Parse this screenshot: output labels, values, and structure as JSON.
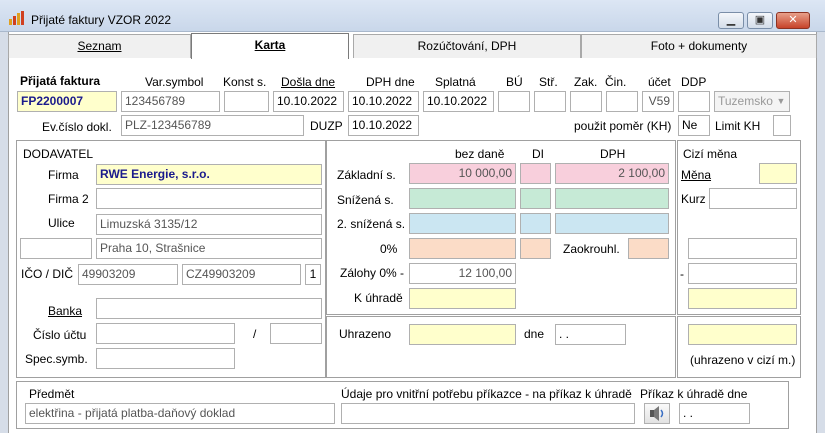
{
  "window": {
    "title": "Přijaté faktury VZOR 2022",
    "min": "▭",
    "max": "□",
    "close": "✕",
    "icon": "chart-icon"
  },
  "tabs": [
    {
      "label": "Seznam"
    },
    {
      "label": "Karta"
    },
    {
      "label": "Rozúčtování, DPH"
    },
    {
      "label": "Foto + dokumenty"
    }
  ],
  "header": {
    "labels": {
      "invoice": "Přijatá faktura",
      "varsym": "Var.symbol",
      "konst": "Konst s.",
      "dosla": "Došla dne",
      "dphdne": "DPH dne",
      "splatna": "Splatná",
      "bu": "BÚ",
      "str": "Stř.",
      "zak": "Zak.",
      "cin": "Čin.",
      "ucet": "účet",
      "ddp": "DDP",
      "evc": "Ev.číslo dokl.",
      "duzp": "DUZP",
      "pomer": "použit poměr (KH)",
      "limit": "Limit KH"
    },
    "values": {
      "invoice": "FP2200007",
      "varsym": "123456789",
      "konst": "",
      "dosla": "10.10.2022",
      "dphdne": "10.10.2022",
      "splatna": "10.10.2022",
      "bu": "",
      "str": "",
      "zak": "",
      "cin": "",
      "ucet": "V59",
      "ddp": "",
      "tuzemsko": "Tuzemsko",
      "evc": "PLZ-123456789",
      "duzp": "10.10.2022",
      "pomer": "Ne",
      "limit": ""
    }
  },
  "supplier": {
    "title": "DODAVATEL",
    "labels": {
      "firma": "Firma",
      "firma2": "Firma 2",
      "ulice": "Ulice",
      "ico": "IČO / DIČ",
      "banka": "Banka",
      "cislo": "Číslo účtu",
      "slash": "/",
      "spec": "Spec.symb."
    },
    "values": {
      "firma": "RWE Energie, s.r.o.",
      "firma2": "",
      "ulice": "Limuzská 3135/12",
      "psc": "",
      "mesto": "Praha 10, Strašnice",
      "ico": "49903209",
      "dic": "CZ49903209",
      "n": "1",
      "banka": "",
      "cislo": "",
      "kod": "",
      "spec": ""
    }
  },
  "amounts": {
    "cols": {
      "bez": "bez daně",
      "di": "DI",
      "dph": "DPH"
    },
    "labels": {
      "zakladni": "Základní s.",
      "snizena": "Snížená s.",
      "snizena2": "2. snížená s.",
      "nula": "0%",
      "zaokr": "Zaokrouhl.",
      "zalohy": "Zálohy 0% -",
      "kuhrade": "K úhradě",
      "uhrazeno": "Uhrazeno",
      "dne": "dne"
    },
    "values": {
      "zakl_bez": "10 000,00",
      "zakl_dph": "2 100,00",
      "zalohy": "12 100,00",
      "kuhrade": "",
      "uhrazeno": "",
      "dne": ". ."
    }
  },
  "foreign": {
    "title": "Cizí měna",
    "mena": "Měna",
    "kurz": "Kurz",
    "dash": "-",
    "note": "(uhrazeno v cizí m.)"
  },
  "bottom": {
    "predmet_label": "Předmět",
    "predmet": "elektřina - přijatá platba-daňový doklad",
    "udaje_label": "Údaje pro vnitřní potřebu příkazce - na příkaz k úhradě",
    "prikaz_label": "Příkaz k úhradě dne",
    "prikaz": ". .",
    "udaje": "",
    "btn_icon": "speaker-icon"
  }
}
